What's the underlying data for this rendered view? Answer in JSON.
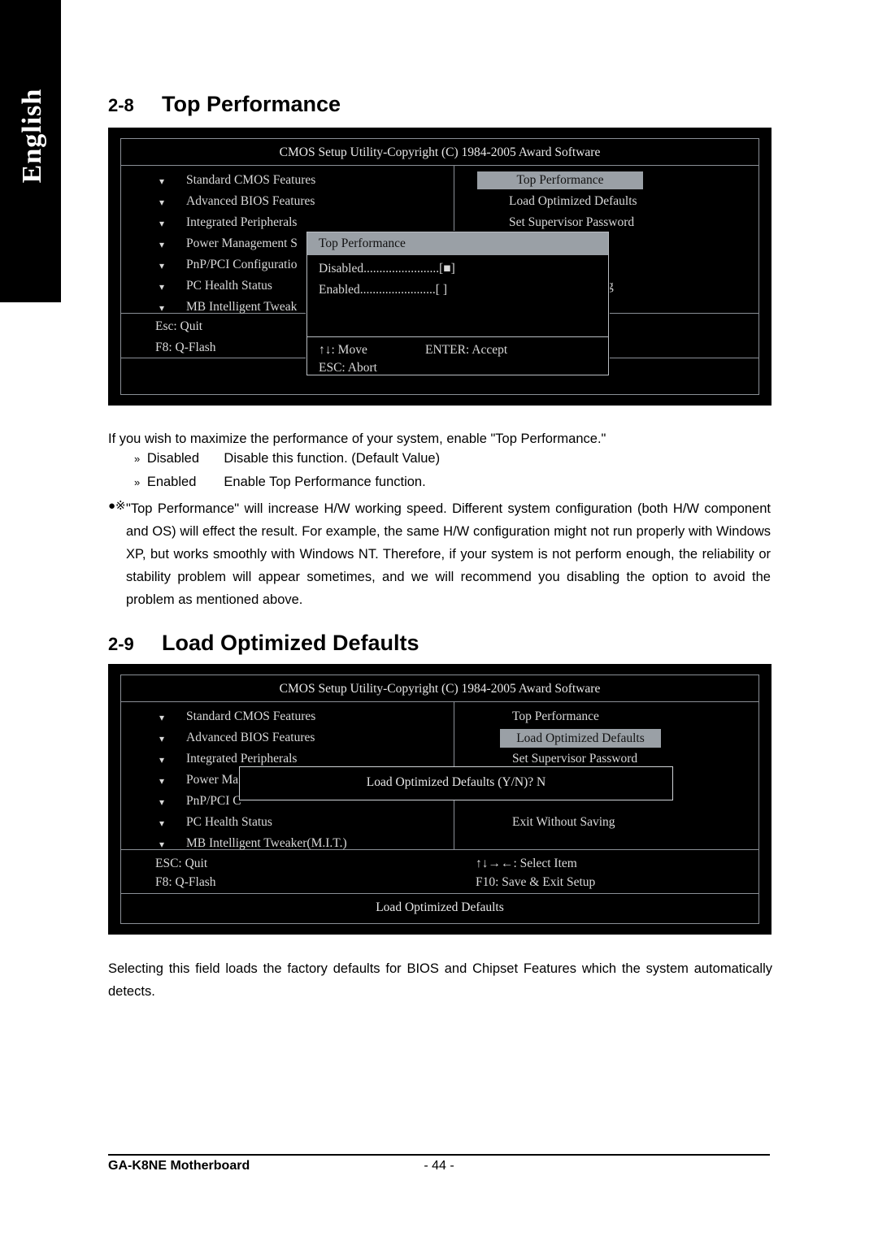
{
  "page": {
    "language_tab": "English",
    "footer_left": "GA-K8NE Motherboard",
    "footer_center": "- 44 -"
  },
  "section_top_performance": {
    "number": "2-8",
    "title": "Top Performance",
    "intro": "If you wish to maximize the performance of your system, enable \"Top Performance.\"",
    "options": [
      {
        "glyph": "»",
        "name": "Disabled",
        "desc": "Disable this function. (Default Value)"
      },
      {
        "glyph": "»",
        "name": "Enabled",
        "desc": "Enable Top Performance function."
      }
    ],
    "note_glyph": "●※",
    "note": "\"Top Performance\" will increase H/W working speed. Different system configuration (both H/W component and OS) will effect the result. For example, the same H/W configuration might not run properly with Windows XP, but works smoothly with Windows NT. Therefore, if your system is not perform enough, the reliability or stability problem will appear sometimes, and we will recommend you disabling the option to avoid the problem as mentioned above."
  },
  "section_load_defaults": {
    "number": "2-9",
    "title": "Load Optimized Defaults",
    "description": "Selecting this field loads the factory defaults for BIOS and Chipset Features which the system automatically detects."
  },
  "bios_screen_1": {
    "title": "CMOS Setup Utility-Copyright (C) 1984-2005 Award Software",
    "left_menu": [
      "Standard CMOS Features",
      "Advanced BIOS Features",
      "Integrated Peripherals",
      "Power Management S",
      "PnP/PCI Configuratio",
      "PC Health Status",
      "MB Intelligent Tweak"
    ],
    "right_menu": [
      "Top Performance",
      "Load Optimized Defaults",
      "Set Supervisor Password"
    ],
    "right_menu_partial": "g",
    "highlighted_item": "Top Performance",
    "footer_left": [
      "Esc: Quit",
      "F8: Q-Flash"
    ],
    "popup": {
      "title": "Top Performance",
      "rows": [
        {
          "label": "Disabled",
          "dots": "........................",
          "value": "[■]"
        },
        {
          "label": "Enabled",
          "dots": "........................",
          "value": "[  ]"
        }
      ],
      "help_move": "↑↓: Move",
      "help_accept": "ENTER: Accept",
      "help_abort": "ESC: Abort"
    }
  },
  "bios_screen_2": {
    "title": "CMOS Setup Utility-Copyright (C) 1984-2005 Award Software",
    "left_menu": [
      "Standard CMOS Features",
      "Advanced BIOS Features",
      "Integrated Peripherals",
      "Power Ma",
      "PnP/PCI C",
      "PC Health Status",
      "MB Intelligent Tweaker(M.I.T.)"
    ],
    "right_menu": [
      "Top Performance",
      "Load Optimized Defaults",
      "Set Supervisor Password",
      "Exit Without Saving"
    ],
    "highlighted_item": "Load Optimized Defaults",
    "confirm_prompt": "Load Optimized Defaults (Y/N)? N",
    "footer_left": [
      "ESC: Quit",
      "F8: Q-Flash"
    ],
    "footer_right": [
      "↑↓→←: Select Item",
      "F10: Save & Exit Setup"
    ],
    "status_bar": "Load Optimized Defaults"
  }
}
